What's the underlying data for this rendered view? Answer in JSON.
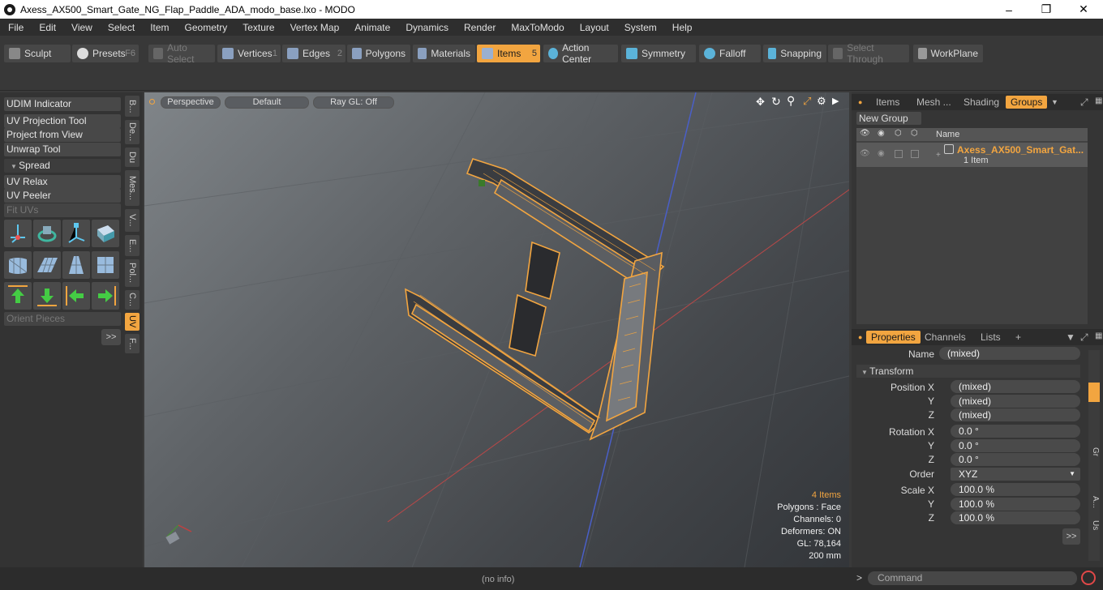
{
  "title": "Axess_AX500_Smart_Gate_NG_Flap_Paddle_ADA_modo_base.lxo - MODO",
  "menu": [
    "File",
    "Edit",
    "View",
    "Select",
    "Item",
    "Geometry",
    "Texture",
    "Vertex Map",
    "Animate",
    "Dynamics",
    "Render",
    "MaxToModo",
    "Layout",
    "System",
    "Help"
  ],
  "toolbar": {
    "sculpt": "Sculpt",
    "presets": "Presets",
    "presets_key": "F6",
    "auto_select": "Auto Select",
    "vertices": "Vertices",
    "vertices_key": "1",
    "edges": "Edges",
    "edges_key": "2",
    "polygons": "Polygons",
    "materials": "Materials",
    "items": "Items",
    "items_key": "5",
    "action_center": "Action Center",
    "symmetry": "Symmetry",
    "falloff": "Falloff",
    "snapping": "Snapping",
    "select_through": "Select Through",
    "workplane": "WorkPlane"
  },
  "left_panel": {
    "buttons": [
      "UDIM Indicator",
      "UV Projection Tool",
      "Project from View",
      "Unwrap Tool",
      "Spread",
      "UV Relax",
      "UV Peeler",
      "Fit UVs",
      "Orient Pieces"
    ],
    "vtabs": [
      "B...",
      "De...",
      "Du",
      "Mes...",
      "V...",
      "E...",
      "Pol...",
      "C...",
      "UV",
      "F..."
    ],
    "more": ">>"
  },
  "viewport": {
    "view": "Perspective",
    "shading": "Default",
    "raygl": "Ray GL: Off",
    "stats": {
      "items": "4 Items",
      "polygons": "Polygons : Face",
      "channels": "Channels: 0",
      "deformers": "Deformers: ON",
      "gl": "GL: 78,164",
      "scale": "200 mm"
    }
  },
  "right_panel": {
    "tabs": [
      "Items",
      "Mesh ...",
      "Shading",
      "Groups"
    ],
    "new_group": "New Group",
    "name_header": "Name",
    "group_name": "Axess_AX500_Smart_Gat...",
    "group_count": "1 Item",
    "prop_tabs": [
      "Properties",
      "Channels",
      "Lists",
      "+"
    ],
    "props": {
      "name_label": "Name",
      "name_value": "(mixed)",
      "transform": "Transform",
      "position_x": "Position X",
      "y": "Y",
      "z": "Z",
      "pos_x": "(mixed)",
      "pos_y": "(mixed)",
      "pos_z": "(mixed)",
      "rotation_x": "Rotation X",
      "rot_x": "0.0 °",
      "rot_y": "0.0 °",
      "rot_z": "0.0 °",
      "order_label": "Order",
      "order": "XYZ",
      "scale_x": "Scale X",
      "sc_x": "100.0 %",
      "sc_y": "100.0 %",
      "sc_z": "100.0 %",
      "more": ">>"
    },
    "side_tabs": [
      "Gr",
      "A...",
      "Us"
    ]
  },
  "status": {
    "info": "(no info)",
    "command": "Command",
    "prompt": ">"
  },
  "colors": {
    "accent": "#f2a540"
  }
}
